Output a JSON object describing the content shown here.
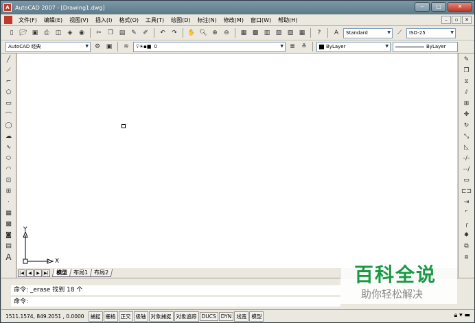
{
  "app": {
    "title": "AutoCAD 2007 - [Drawing1.dwg]",
    "icon_letter": "A"
  },
  "window_buttons": {
    "minimize": "–",
    "maximize": "□",
    "close": "✕"
  },
  "menubar": {
    "items": [
      "文件(F)",
      "编辑(E)",
      "视图(V)",
      "插入(I)",
      "格式(O)",
      "工具(T)",
      "绘图(D)",
      "标注(N)",
      "修改(M)",
      "窗口(W)",
      "帮助(H)"
    ],
    "mdi_buttons": [
      "–",
      "▫",
      "✕"
    ]
  },
  "toolbar": {
    "text_style": "Standard",
    "dim_style": "ISO-25"
  },
  "toolbar2": {
    "workspace": "AutoCAD 经典",
    "layer": "0",
    "color": "ByLayer",
    "linetype": "ByLayer"
  },
  "ucs": {
    "y_label": "Y",
    "x_label": "X"
  },
  "layout_tabs": [
    "模型",
    "布局1",
    "布局2"
  ],
  "command": {
    "history": "命令: _erase 找到 18 个",
    "prompt": "命令:"
  },
  "status": {
    "coordinates": "1511.1574, 849.2051 , 0.0000",
    "buttons": [
      "捕捉",
      "栅格",
      "正交",
      "极轴",
      "对象捕捉",
      "对象追踪",
      "DUCS",
      "DYN",
      "线宽",
      "模型"
    ]
  },
  "watermark": {
    "main": "百科全说",
    "sub": "助你轻松解决"
  },
  "colors": {
    "accent_green": "#1a9a45",
    "titlebar": "#5e7a88"
  }
}
